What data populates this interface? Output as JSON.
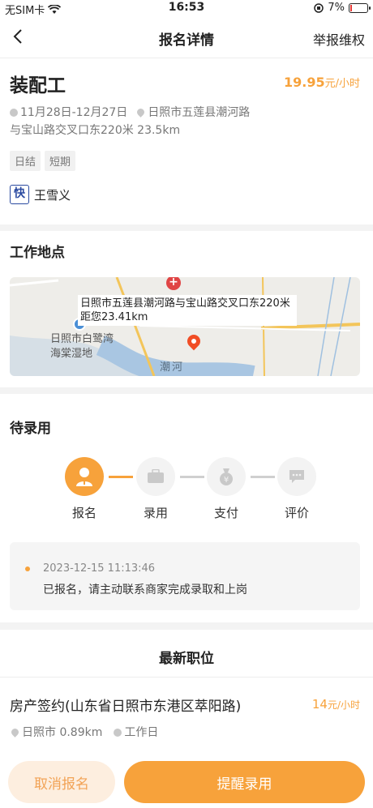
{
  "status_bar": {
    "carrier": "无SIM卡",
    "time": "16:53",
    "battery": "7%"
  },
  "nav": {
    "title": "报名详情",
    "report": "举报维权"
  },
  "job": {
    "title": "装配工",
    "price": "19.95",
    "price_unit": "元/小时",
    "date_range": "11月28日-12月27日",
    "address_line1": "日照市五莲县潮河路",
    "address_line2": "与宝山路交叉口东220米 23.5km",
    "tags": [
      "日结",
      "短期"
    ],
    "employer_logo": "快",
    "employer": "王雪义"
  },
  "work_location": {
    "title": "工作地点",
    "map_label": "日照市五莲县潮河路与宝山路交叉口东220米 距您23.41km",
    "poi_label": "日照市白鹭湾海棠湿地",
    "river_label": "潮河",
    "hospital_mark": "+"
  },
  "progress": {
    "title": "待录用",
    "steps": [
      {
        "label": "报名",
        "active": true,
        "icon": "person-icon"
      },
      {
        "label": "录用",
        "active": false,
        "icon": "briefcase-icon"
      },
      {
        "label": "支付",
        "active": false,
        "icon": "money-bag-icon"
      },
      {
        "label": "评价",
        "active": false,
        "icon": "comment-icon"
      }
    ],
    "note_time": "2023-12-15 11:13:46",
    "note_msg": "已报名，请主动联系商家完成录取和上岗"
  },
  "latest": {
    "title": "最新职位",
    "job_title": "房产签约(山东省日照市东港区萃阳路)",
    "job_price": "14",
    "job_price_unit": "元/小时",
    "job_location": "日照市 0.89km",
    "job_type": "工作日"
  },
  "actions": {
    "cancel": "取消报名",
    "remind": "提醒录用"
  },
  "colors": {
    "accent": "#f7a23b",
    "accent_light": "#fdeedf"
  }
}
